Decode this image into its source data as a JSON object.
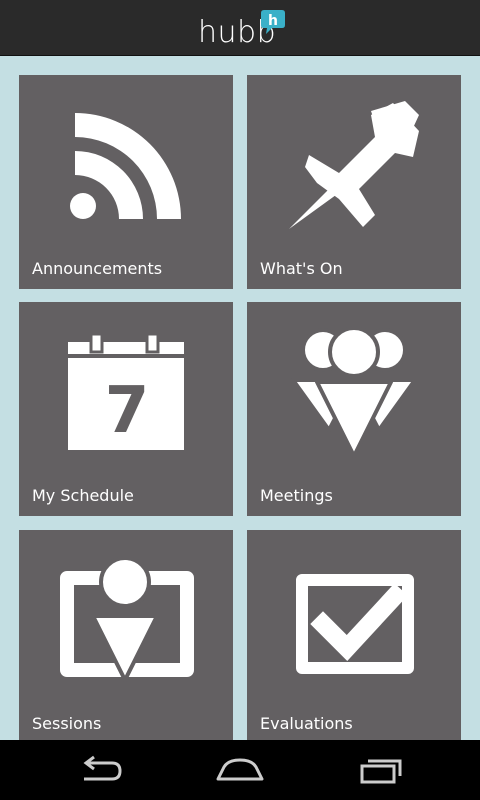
{
  "app": {
    "logo_text": "hubb",
    "badge_letter": "h",
    "accent": "#3ab0c8"
  },
  "tiles": [
    {
      "label": "Announcements",
      "icon": "rss-icon"
    },
    {
      "label": "What's On",
      "icon": "pushpin-icon"
    },
    {
      "label": "My Schedule",
      "icon": "calendar-icon",
      "calendar_day": "7"
    },
    {
      "label": "Meetings",
      "icon": "people-icon"
    },
    {
      "label": "Sessions",
      "icon": "presenter-icon"
    },
    {
      "label": "Evaluations",
      "icon": "checkbox-icon"
    }
  ],
  "navbar": {
    "buttons": [
      "back-icon",
      "home-icon",
      "recent-apps-icon"
    ]
  },
  "colors": {
    "background": "#c4dfe3",
    "tile": "#636062",
    "appbar": "#2a2a2a",
    "navbar": "#000000",
    "icon": "#ffffff"
  }
}
